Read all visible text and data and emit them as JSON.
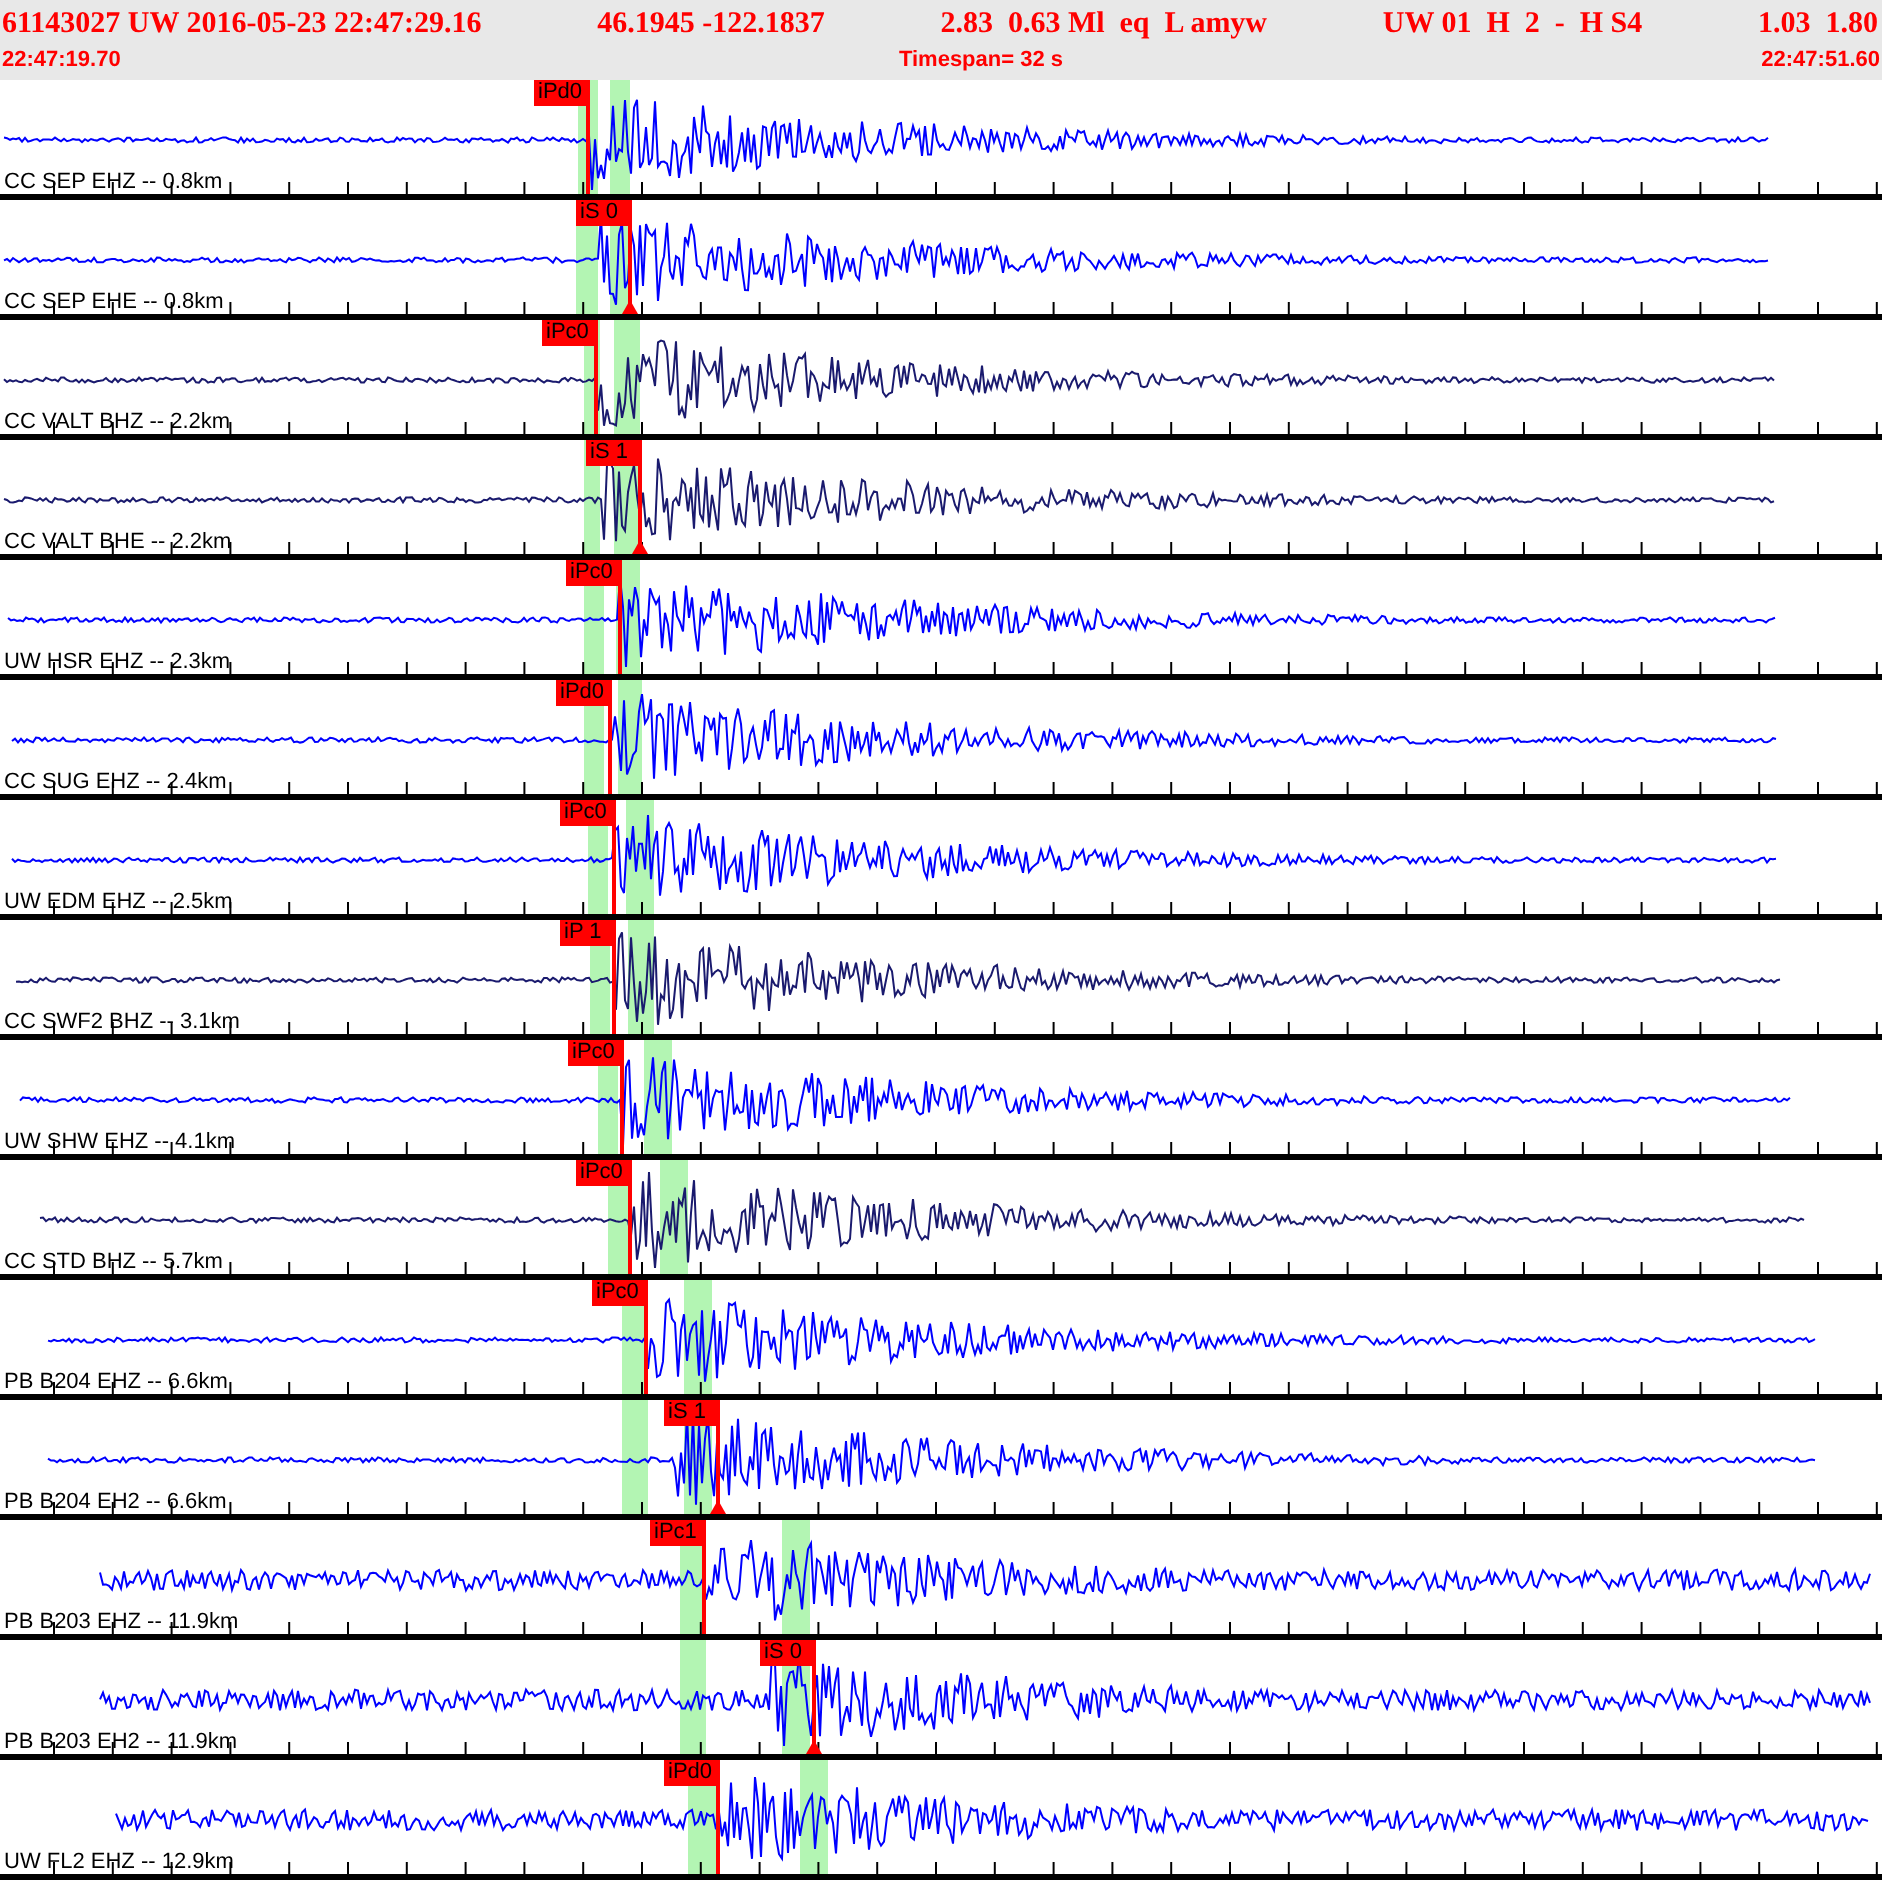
{
  "header": {
    "segments": [
      "61143027 UW 2016-05-23 22:47:29.16",
      "46.1945 -122.1837",
      "2.83  0.63 Ml  eq  L amyw",
      "UW 01  H  2  -  H S4",
      "1.03  1.80"
    ],
    "start_time": "22:47:19.70",
    "timespan": "Timespan=  32 s",
    "end_time": "22:47:51.60"
  },
  "traces": [
    {
      "label": "CC SEP EHZ -- 0.8km",
      "pick": "iPd0",
      "kind": "P",
      "color": "#0000ff"
    },
    {
      "label": "CC SEP EHE -- 0.8km",
      "pick": "iS 0",
      "kind": "S",
      "color": "#0000ff"
    },
    {
      "label": "CC VALT BHZ -- 2.2km",
      "pick": "iPc0",
      "kind": "P",
      "color": "#1a1a6e"
    },
    {
      "label": "CC VALT BHE -- 2.2km",
      "pick": "iS 1",
      "kind": "S",
      "color": "#1a1a6e"
    },
    {
      "label": "UW HSR EHZ -- 2.3km",
      "pick": "iPc0",
      "kind": "P",
      "color": "#0000ff"
    },
    {
      "label": "CC SUG EHZ -- 2.4km",
      "pick": "iPd0",
      "kind": "P",
      "color": "#0000ff"
    },
    {
      "label": "UW EDM EHZ -- 2.5km",
      "pick": "iPc0",
      "kind": "P",
      "color": "#0000ff"
    },
    {
      "label": "CC SWF2 BHZ -- 3.1km",
      "pick": "iP 1",
      "kind": "P",
      "color": "#1a1a6e"
    },
    {
      "label": "UW SHW EHZ -- 4.1km",
      "pick": "iPc0",
      "kind": "P",
      "color": "#0000ff"
    },
    {
      "label": "CC STD BHZ -- 5.7km",
      "pick": "iPc0",
      "kind": "P",
      "color": "#1a1a6e"
    },
    {
      "label": "PB B204 EHZ -- 6.6km",
      "pick": "iPc0",
      "kind": "P",
      "color": "#0000ff"
    },
    {
      "label": "PB B204 EH2 -- 6.6km",
      "pick": "iS 1",
      "kind": "S",
      "color": "#0000ff"
    },
    {
      "label": "PB B203 EHZ -- 11.9km",
      "pick": "iPc1",
      "kind": "P",
      "color": "#0000ff"
    },
    {
      "label": "PB B203 EH2 -- 11.9km",
      "pick": "iS 0",
      "kind": "S",
      "color": "#0000ff"
    },
    {
      "label": "UW FL2 EHZ -- 12.9km",
      "pick": "iPd0",
      "kind": "P",
      "color": "#0000ff"
    }
  ]
}
